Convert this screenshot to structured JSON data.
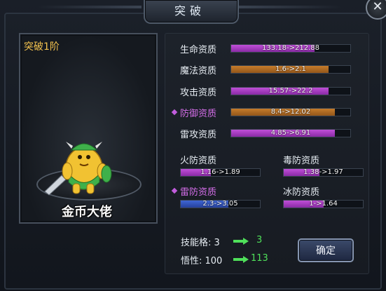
{
  "header": {
    "title": "突破"
  },
  "close_button": {
    "label": "✕"
  },
  "preview": {
    "level": "突破1阶",
    "character_name": "金币大佬"
  },
  "main_stats": [
    {
      "label": "生命资质",
      "text": "133.18->212.88",
      "color": "purple",
      "fill": 0.7,
      "highlight": false
    },
    {
      "label": "魔法资质",
      "text": "1.6->2.1",
      "color": "orange",
      "fill": 0.82,
      "highlight": false
    },
    {
      "label": "攻击资质",
      "text": "15.57->22.2",
      "color": "purple",
      "fill": 0.82,
      "highlight": false
    },
    {
      "label": "防御资质",
      "text": "8.4->12.02",
      "color": "orange",
      "fill": 0.87,
      "highlight": true
    },
    {
      "label": "雷攻资质",
      "text": "4.85->6.91",
      "color": "purple",
      "fill": 0.87,
      "highlight": false
    }
  ],
  "resist_stats": [
    {
      "label": "火防资质",
      "text": "1.16->1.89",
      "color": "purple",
      "fill": 0.38,
      "highlight": false
    },
    {
      "label": "毒防资质",
      "text": "1.38->1.97",
      "color": "purple",
      "fill": 0.45,
      "highlight": false
    },
    {
      "label": "雷防资质",
      "text": "2.3->3.05",
      "color": "blue",
      "fill": 0.6,
      "highlight": true
    },
    {
      "label": "冰防资质",
      "text": "1->1.64",
      "color": "purple",
      "fill": 0.5,
      "highlight": false
    }
  ],
  "skill_slots": {
    "label": "技能格: 3",
    "new": "3"
  },
  "comprehension": {
    "label": "悟性: 100",
    "new": "113"
  },
  "confirm_button": {
    "label": "确定"
  },
  "colors": {
    "accent_purple": "#c04fd8",
    "accent_orange": "#c67c2b",
    "accent_blue": "#3f66d4",
    "new_value_green": "#4fe05a",
    "level_gold": "#f2c14e"
  }
}
